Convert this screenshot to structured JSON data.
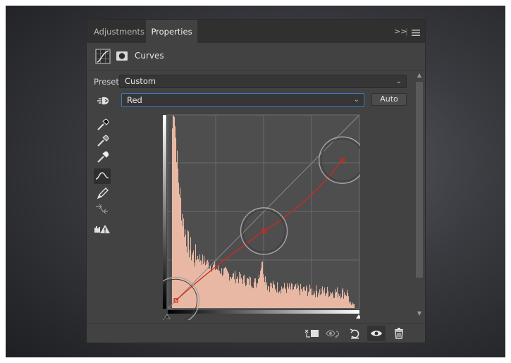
{
  "tabs": {
    "adjustments": "Adjustments",
    "properties": "Properties",
    "collapse": ">>"
  },
  "panel_title": "Curves",
  "preset": {
    "label": "Preset:",
    "value": "Custom"
  },
  "channel": {
    "value": "Red"
  },
  "auto_label": "Auto",
  "tools": [
    "on-image-adjust-icon",
    "black-point-eyedropper-icon",
    "gray-point-eyedropper-icon",
    "white-point-eyedropper-icon",
    "curve-points-icon",
    "pencil-icon",
    "smooth-icon",
    "clipping-warning-icon"
  ],
  "curve": {
    "color": "#d2281e",
    "points": [
      [
        10,
        10
      ],
      [
        128,
        102
      ],
      [
        233,
        196
      ]
    ]
  },
  "colors": {
    "panel": "#424242",
    "histogram": "#e8b8a4",
    "accent": "#3f79c4"
  },
  "footer_buttons": [
    "clip-to-layer-icon",
    "view-previous-icon",
    "reset-icon",
    "visibility-eye-icon",
    "trash-icon"
  ]
}
